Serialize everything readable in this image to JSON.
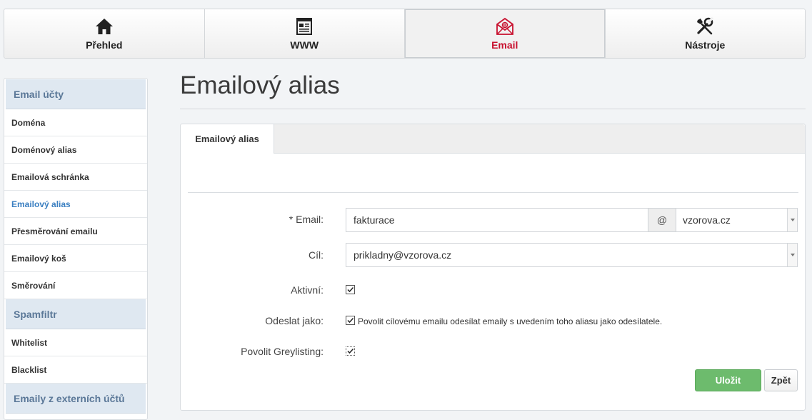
{
  "topnav": [
    {
      "label": "Přehled",
      "icon": "home-icon"
    },
    {
      "label": "WWW",
      "icon": "webpage-icon"
    },
    {
      "label": "Email",
      "icon": "email-envelope-icon",
      "active": true
    },
    {
      "label": "Nástroje",
      "icon": "tools-icon"
    }
  ],
  "sidebar": {
    "sections": [
      {
        "title": "Email účty",
        "items": [
          "Doména",
          "Doménový alias",
          "Emailová schránka",
          "Emailový alias",
          "Přesměrování emailu",
          "Emailový koš",
          "Směrování"
        ]
      },
      {
        "title": "Spamfiltr",
        "items": [
          "Whitelist",
          "Blacklist"
        ]
      },
      {
        "title": "Emaily z externích účtů",
        "items": []
      }
    ],
    "active_item": "Emailový alias"
  },
  "page": {
    "title": "Emailový alias",
    "tab": "Emailový alias"
  },
  "form": {
    "email_label": "* Email:",
    "email_value": "fakturace",
    "at_sign": "@",
    "domain_value": "vzorova.cz",
    "target_label": "Cíl:",
    "target_value": "prikladny@vzorova.cz",
    "active_label": "Aktivní:",
    "active_checked": true,
    "sendas_label": "Odeslat jako:",
    "sendas_checked": true,
    "sendas_text": "Povolit cílovému emailu odesílat emaily s uvedením toho aliasu jako odesílatele.",
    "greylist_label": "Povolit Greylisting:",
    "greylist_checked": true,
    "save_label": "Uložit",
    "back_label": "Zpět"
  },
  "colors": {
    "accent_red": "#c8102e",
    "sidebar_header_bg": "#dfe8f1",
    "active_link": "#3a7fc1",
    "save_green": "#6dbb6d"
  }
}
